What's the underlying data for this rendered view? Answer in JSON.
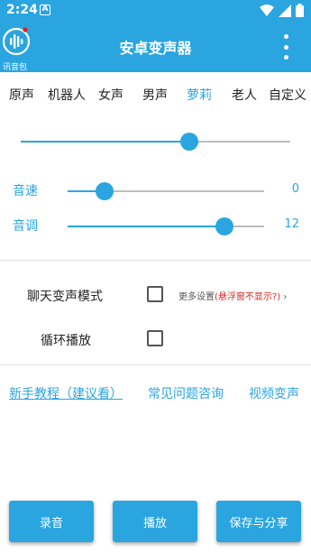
{
  "status": {
    "time": "2:24",
    "a_badge": "A"
  },
  "appbar": {
    "logo_text": "讯音包",
    "title": "安卓变声器"
  },
  "tabs": [
    "原声",
    "机器人",
    "女声",
    "男声",
    "萝莉",
    "老人",
    "自定义"
  ],
  "active_tab": "萝莉",
  "main_slider": {
    "value_fraction": 0.625
  },
  "speed": {
    "label": "音速",
    "value": "0",
    "fraction": 0.19
  },
  "pitch": {
    "label": "音调",
    "value": "12",
    "fraction": 0.8
  },
  "chat_mode": {
    "label": "聊天变声模式",
    "checked": false
  },
  "more_settings": {
    "prefix": "更多设置",
    "warning": "(悬浮窗不显示?)",
    "chevron": "›"
  },
  "loop": {
    "label": "循环播放",
    "checked": false
  },
  "links": {
    "tutorial": "新手教程（建议看）",
    "faq": "常见问题咨询",
    "video": "视频变声"
  },
  "buttons": {
    "record": "录音",
    "play": "播放",
    "save_share": "保存与分享"
  },
  "colors": {
    "accent": "#2aa5e0",
    "warning": "#e02020"
  },
  "icons": {
    "wifi": "wifi-icon",
    "cell": "cell-signal-icon",
    "battery": "battery-icon",
    "more": "more-vert-icon",
    "logo": "voice-logo-icon"
  }
}
